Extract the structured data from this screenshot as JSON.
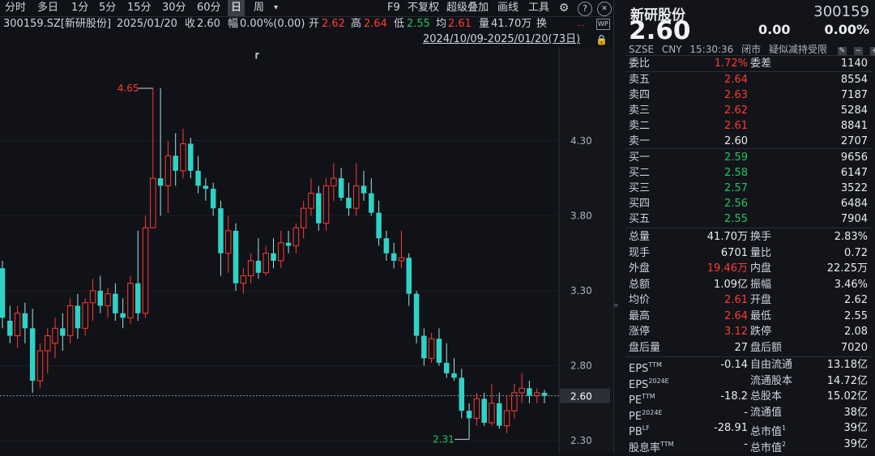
{
  "toolbar": {
    "periods": [
      "分时",
      "多日",
      "1分",
      "5分",
      "15分",
      "30分",
      "60分",
      "日",
      "周"
    ],
    "active_period": "日",
    "period_menu": "▾",
    "f9": "F9",
    "fq": "不复权",
    "overlay": "超级叠加",
    "draw": "画线",
    "tools": "工具"
  },
  "quote": {
    "code_name": "300159.SZ[新研股份]",
    "date": "2025/01/20",
    "close_label": "收",
    "close": "2.60",
    "range_label": "幅",
    "range": "0.00%(0.00)",
    "open_label": "开",
    "open": "2.62",
    "high_label": "高",
    "high": "2.64",
    "low_label": "低",
    "low": "2.55",
    "avg_label": "均",
    "avg": "2.61",
    "vol_label": "量",
    "vol": "41.70万",
    "turn_label": "换",
    "date_range": "2024/10/09-2025/01/20(73日)"
  },
  "panel": {
    "name": "新研股份",
    "code": "300159",
    "price": "2.60",
    "change": "0.00",
    "pct": "0.00%",
    "info": [
      "SZSE",
      "CNY",
      "15:30:36",
      "闭市",
      "疑似减持受限"
    ],
    "weibi": {
      "l1": "委比",
      "v1": "1.72%",
      "l2": "委差",
      "v2": "1140"
    },
    "sells": [
      {
        "label": "卖五",
        "price": "2.64",
        "vol": "8554"
      },
      {
        "label": "卖四",
        "price": "2.63",
        "vol": "7187"
      },
      {
        "label": "卖三",
        "price": "2.62",
        "vol": "5284"
      },
      {
        "label": "卖二",
        "price": "2.61",
        "vol": "8841"
      },
      {
        "label": "卖一",
        "price": "2.60",
        "vol": "2707"
      }
    ],
    "buys": [
      {
        "label": "买一",
        "price": "2.59",
        "vol": "9656"
      },
      {
        "label": "买二",
        "price": "2.58",
        "vol": "6147"
      },
      {
        "label": "买三",
        "price": "2.57",
        "vol": "3522"
      },
      {
        "label": "买四",
        "price": "2.56",
        "vol": "6484"
      },
      {
        "label": "买五",
        "price": "2.55",
        "vol": "7904"
      }
    ],
    "stats": [
      {
        "l1": "总量",
        "v1": "41.70万",
        "c1": "white",
        "l2": "换手",
        "v2": "2.83%"
      },
      {
        "l1": "现手",
        "v1": "6701",
        "c1": "white",
        "l2": "量比",
        "v2": "0.72"
      },
      {
        "l1": "外盘",
        "v1": "19.46万",
        "c1": "red",
        "l2": "内盘",
        "v2": "22.25万",
        "c2": "green"
      },
      {
        "l1": "总额",
        "v1": "1.09亿",
        "c1": "white",
        "l2": "振幅",
        "v2": "3.46%"
      },
      {
        "l1": "均价",
        "v1": "2.61",
        "c1": "red",
        "l2": "开盘",
        "v2": "2.62",
        "c2": "red"
      },
      {
        "l1": "最高",
        "v1": "2.64",
        "c1": "red",
        "l2": "最低",
        "v2": "2.55",
        "c2": "green"
      },
      {
        "l1": "涨停",
        "v1": "3.12",
        "c1": "red",
        "l2": "跌停",
        "v2": "2.08",
        "c2": "green"
      },
      {
        "l1": "盘后量",
        "v1": "27",
        "c1": "white",
        "l2": "盘后额",
        "v2": "7020"
      }
    ],
    "fund": [
      {
        "l1": "EPS",
        "s1": "TTM",
        "v1": "-0.14",
        "l2": "自由流通",
        "v2": "13.18亿"
      },
      {
        "l1": "EPS",
        "s1": "2024E",
        "v1": "",
        "l2": "流通股本",
        "v2": "14.72亿"
      },
      {
        "l1": "PE",
        "s1": "TTM",
        "v1": "-18.2",
        "l2": "总股本",
        "v2": "15.02亿"
      },
      {
        "l1": "PE",
        "s1": "2024E",
        "v1": "-",
        "l2": "流通值",
        "v2": "38亿"
      },
      {
        "l1": "PB",
        "s1": "LF",
        "v1": "-28.91",
        "l2": "总市值",
        "s2": "1",
        "v2": "39亿"
      },
      {
        "l1": "股息率",
        "s1": "TTM",
        "v1": "-",
        "l2": "总市值",
        "s2": "2",
        "v2": "39亿"
      }
    ]
  },
  "colors": {
    "up": "#ff3b30",
    "down": "#2ed3c6",
    "grid": "#2a2e37",
    "bg": "#101218"
  },
  "chart_data": {
    "type": "candlestick",
    "y_ticks": [
      "4.30",
      "3.80",
      "3.30",
      "2.80",
      "2.30"
    ],
    "y_tick_values": [
      4.3,
      3.8,
      3.3,
      2.8,
      2.3
    ],
    "ylim": [
      2.22,
      4.92
    ],
    "current_price": 2.6,
    "current_label": "2.60",
    "max_label": "4.65",
    "max_value": 4.65,
    "min_label": "2.31",
    "min_value": 2.31,
    "candles": [
      [
        3.45,
        3.5,
        3.05,
        3.12
      ],
      [
        3.1,
        3.2,
        2.95,
        3.0
      ],
      [
        3.0,
        3.2,
        2.92,
        3.15
      ],
      [
        3.15,
        3.22,
        2.95,
        3.05
      ],
      [
        3.05,
        3.18,
        2.62,
        2.7
      ],
      [
        2.7,
        2.95,
        2.65,
        2.9
      ],
      [
        2.9,
        3.05,
        2.75,
        3.0
      ],
      [
        2.95,
        3.12,
        2.85,
        3.05
      ],
      [
        3.05,
        3.15,
        2.9,
        3.0
      ],
      [
        3.0,
        3.25,
        2.95,
        3.2
      ],
      [
        3.2,
        3.28,
        2.98,
        3.05
      ],
      [
        3.05,
        3.25,
        3.0,
        3.22
      ],
      [
        3.22,
        3.38,
        3.1,
        3.3
      ],
      [
        3.3,
        3.4,
        3.15,
        3.2
      ],
      [
        3.2,
        3.32,
        3.12,
        3.28
      ],
      [
        3.28,
        3.35,
        3.1,
        3.15
      ],
      [
        3.15,
        3.25,
        3.05,
        3.12
      ],
      [
        3.12,
        3.4,
        3.08,
        3.35
      ],
      [
        3.35,
        3.7,
        3.1,
        3.15
      ],
      [
        3.15,
        3.8,
        3.12,
        3.72
      ],
      [
        3.72,
        4.65,
        3.72,
        4.05
      ],
      [
        4.05,
        4.65,
        3.8,
        4.0
      ],
      [
        4.0,
        4.3,
        3.82,
        4.2
      ],
      [
        4.2,
        4.35,
        4.0,
        4.1
      ],
      [
        4.1,
        4.38,
        4.05,
        4.28
      ],
      [
        4.28,
        4.32,
        4.05,
        4.1
      ],
      [
        4.1,
        4.2,
        3.95,
        4.0
      ],
      [
        4.0,
        4.05,
        3.9,
        3.98
      ],
      [
        3.98,
        4.02,
        3.8,
        3.85
      ],
      [
        3.85,
        3.9,
        3.4,
        3.55
      ],
      [
        3.55,
        3.8,
        3.42,
        3.7
      ],
      [
        3.7,
        3.75,
        3.3,
        3.35
      ],
      [
        3.35,
        3.45,
        3.28,
        3.4
      ],
      [
        3.4,
        3.55,
        3.35,
        3.5
      ],
      [
        3.5,
        3.65,
        3.38,
        3.42
      ],
      [
        3.42,
        3.6,
        3.4,
        3.55
      ],
      [
        3.55,
        3.65,
        3.45,
        3.5
      ],
      [
        3.5,
        3.7,
        3.45,
        3.62
      ],
      [
        3.62,
        3.7,
        3.55,
        3.6
      ],
      [
        3.6,
        3.75,
        3.55,
        3.72
      ],
      [
        3.72,
        3.9,
        3.65,
        3.85
      ],
      [
        3.85,
        4.05,
        3.8,
        3.95
      ],
      [
        3.95,
        4.0,
        3.7,
        3.75
      ],
      [
        3.75,
        4.05,
        3.7,
        4.0
      ],
      [
        4.0,
        4.15,
        3.9,
        4.05
      ],
      [
        4.05,
        4.12,
        3.9,
        3.92
      ],
      [
        3.92,
        4.02,
        3.8,
        3.85
      ],
      [
        3.85,
        4.15,
        3.8,
        4.0
      ],
      [
        4.0,
        4.1,
        3.9,
        3.95
      ],
      [
        3.95,
        4.05,
        3.8,
        3.82
      ],
      [
        3.82,
        3.9,
        3.6,
        3.65
      ],
      [
        3.65,
        3.7,
        3.5,
        3.55
      ],
      [
        3.55,
        3.62,
        3.45,
        3.5
      ],
      [
        3.5,
        3.7,
        3.45,
        3.52
      ],
      [
        3.52,
        3.55,
        3.2,
        3.28
      ],
      [
        3.28,
        3.3,
        2.95,
        3.0
      ],
      [
        3.0,
        3.05,
        2.8,
        2.85
      ],
      [
        2.85,
        3.02,
        2.82,
        2.98
      ],
      [
        2.98,
        3.05,
        2.8,
        2.82
      ],
      [
        2.82,
        2.95,
        2.72,
        2.75
      ],
      [
        2.75,
        2.85,
        2.7,
        2.72
      ],
      [
        2.72,
        2.78,
        2.45,
        2.5
      ],
      [
        2.5,
        2.55,
        2.31,
        2.45
      ],
      [
        2.45,
        2.62,
        2.4,
        2.58
      ],
      [
        2.58,
        2.62,
        2.4,
        2.42
      ],
      [
        2.42,
        2.68,
        2.4,
        2.55
      ],
      [
        2.55,
        2.62,
        2.38,
        2.4
      ],
      [
        2.4,
        2.6,
        2.35,
        2.5
      ],
      [
        2.5,
        2.68,
        2.45,
        2.62
      ],
      [
        2.62,
        2.75,
        2.55,
        2.65
      ],
      [
        2.65,
        2.7,
        2.55,
        2.6
      ],
      [
        2.6,
        2.65,
        2.55,
        2.62
      ],
      [
        2.62,
        2.64,
        2.55,
        2.6
      ]
    ]
  }
}
